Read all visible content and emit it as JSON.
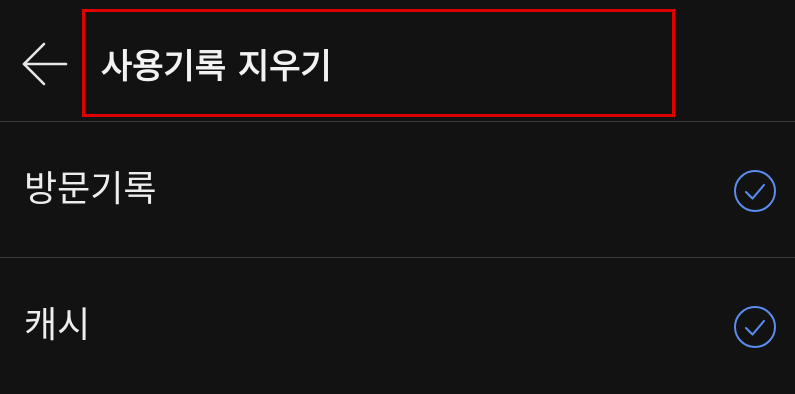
{
  "header": {
    "back_icon": "arrow-left-icon",
    "title": "사용기록 지우기",
    "highlight_color": "#e00000"
  },
  "options": [
    {
      "label": "방문기록",
      "checked": true,
      "icon": "check-circle-icon"
    },
    {
      "label": "캐시",
      "checked": true,
      "icon": "check-circle-icon"
    }
  ],
  "colors": {
    "background": "#121212",
    "text": "#ededed",
    "accent": "#5b8def",
    "divider": "#3a3a3a"
  }
}
